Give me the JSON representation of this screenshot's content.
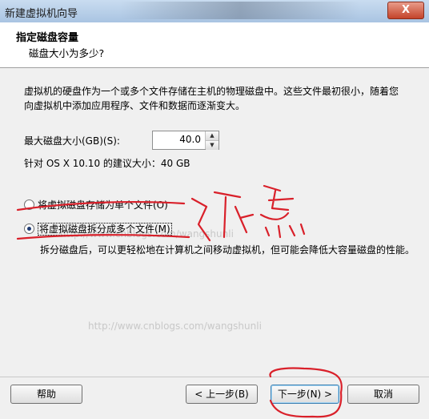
{
  "window": {
    "title": "新建虚拟机向导",
    "close_label": "X"
  },
  "header": {
    "title": "指定磁盘容量",
    "subtitle": "磁盘大小为多少?"
  },
  "description": "虚拟机的硬盘作为一个或多个文件存储在主机的物理磁盘中。这些文件最初很小，随着您向虚拟机中添加应用程序、文件和数据而逐渐变大。",
  "disk_size": {
    "label": "最大磁盘大小(GB)(S):",
    "value": "40.0",
    "up_glyph": "▲",
    "down_glyph": "▼"
  },
  "recommendation": "针对 OS X 10.10 的建议大小：40 GB",
  "options": {
    "single_file": "将虚拟磁盘存储为单个文件(O)",
    "multi_file": "将虚拟磁盘拆分成多个文件(M)",
    "selected": "multi_file",
    "multi_desc": "拆分磁盘后，可以更轻松地在计算机之间移动虚拟机，但可能会降低大容量磁盘的性能。"
  },
  "watermark": {
    "text": "http://www.cnblogs.com/wangshunli"
  },
  "annotation_text": "随意",
  "buttons": {
    "help": "帮助",
    "back": "< 上一步(B)",
    "next": "下一步(N) >",
    "cancel": "取消"
  },
  "colors": {
    "title_bar": "#b8d0ea",
    "annotation_red": "#d9202a"
  }
}
